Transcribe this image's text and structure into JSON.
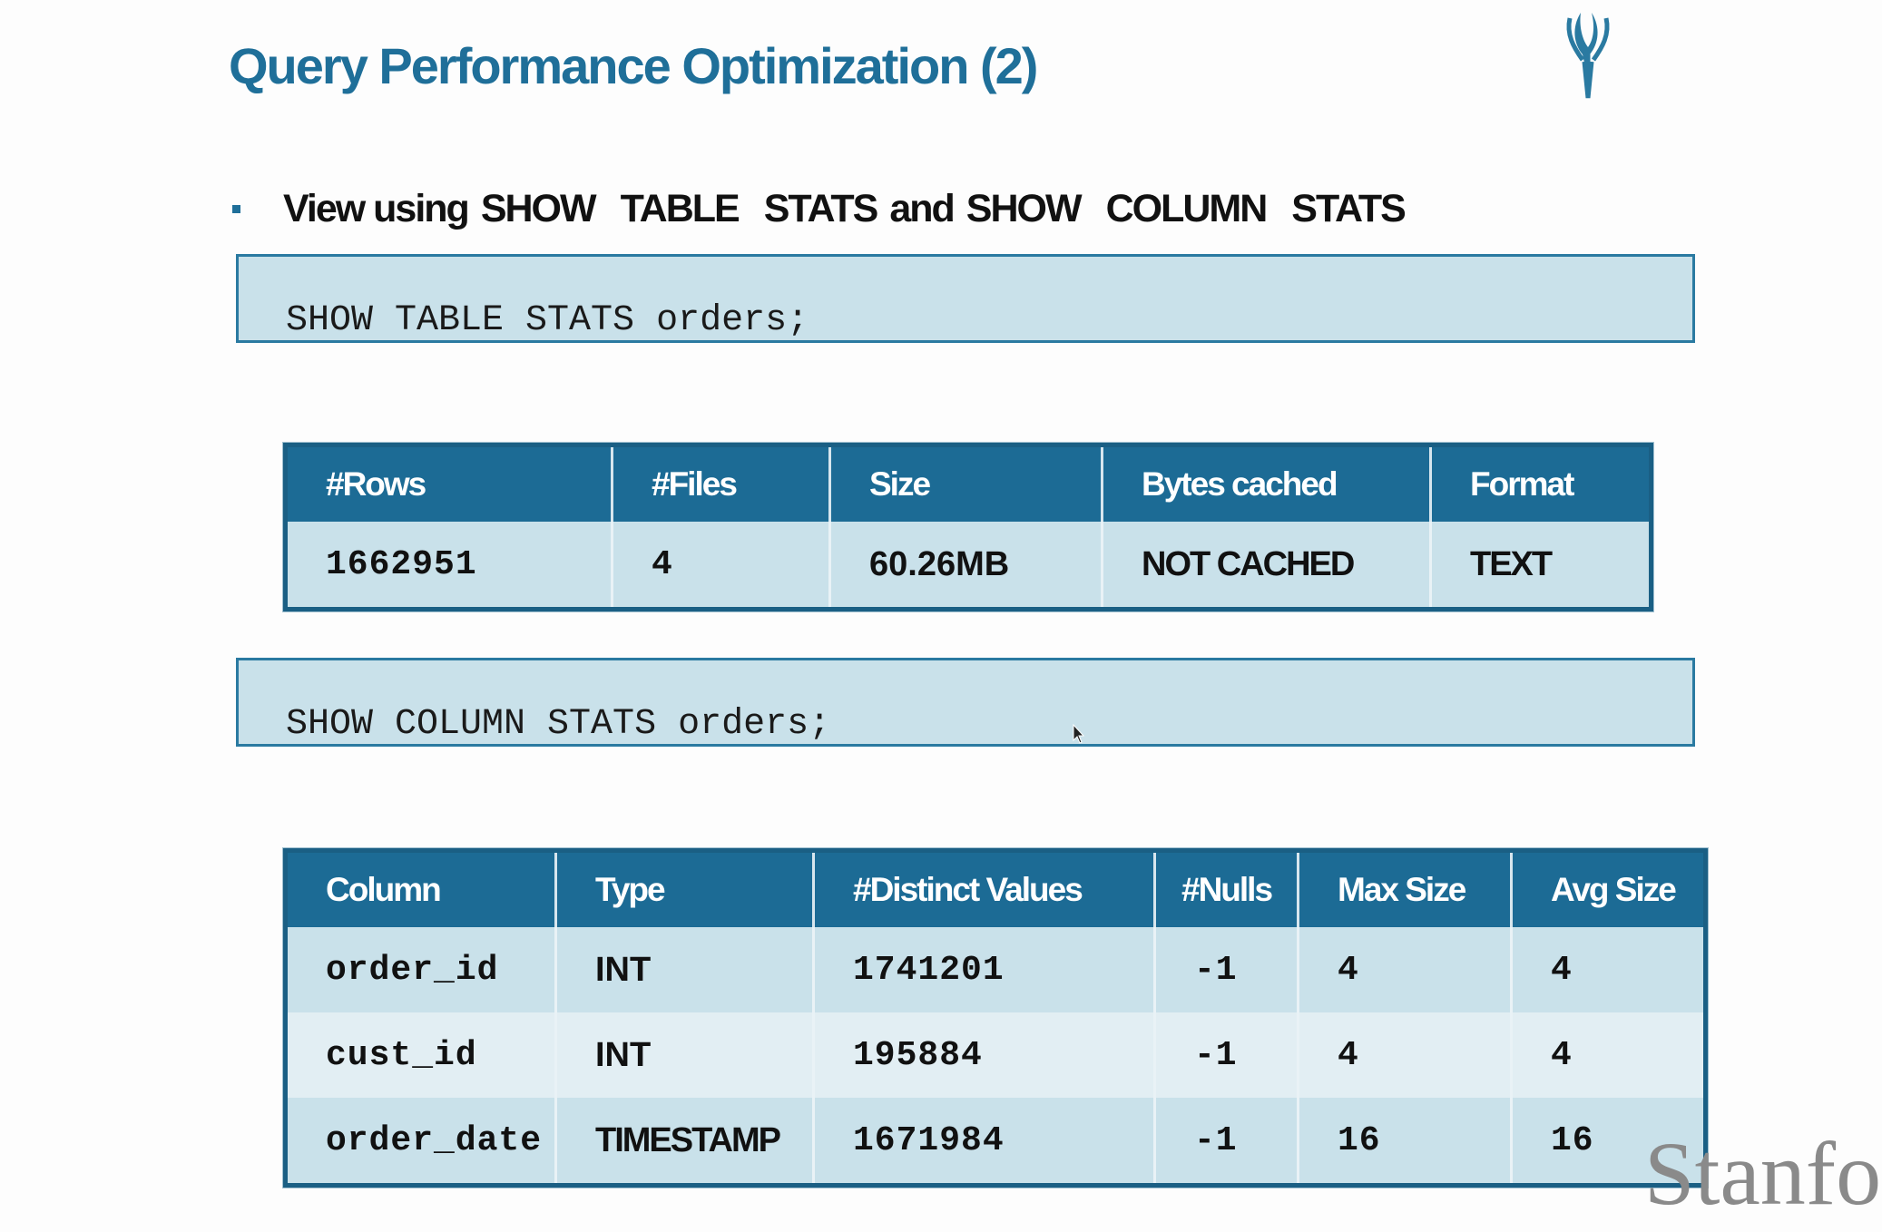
{
  "title": "Query Performance Optimization (2)",
  "bullet": {
    "prefix": "View using",
    "keyword_1a": "SHOW",
    "keyword_1b": "TABLE",
    "keyword_1c": "STATS",
    "joiner": "and",
    "keyword_2a": "SHOW",
    "keyword_2b": "COLUMN",
    "keyword_2c": "STATS"
  },
  "code_1": "SHOW TABLE STATS orders;",
  "code_2": "SHOW COLUMN STATS orders;",
  "table_stats": {
    "headers": [
      "#Rows",
      "#Files",
      "Size",
      "Bytes cached",
      "Format"
    ],
    "rows": [
      [
        "1662951",
        "4",
        "60.26MB",
        "NOT CACHED",
        "TEXT"
      ]
    ]
  },
  "column_stats": {
    "headers": [
      "Column",
      "Type",
      "#Distinct Values",
      "#Nulls",
      "Max Size",
      "Avg Size"
    ],
    "rows": [
      [
        "order_id",
        "INT",
        "1741201",
        "-1",
        "4",
        "4"
      ],
      [
        "cust_id",
        "INT",
        "195884",
        "-1",
        "4",
        "4"
      ],
      [
        "order_date",
        "TIMESTAMP",
        "1671984",
        "-1",
        "16",
        "16"
      ]
    ]
  },
  "watermark": "Stanfo",
  "colors": {
    "title": "#1f6f99",
    "header_bg": "#1c6b95",
    "code_bg": "#c9e1ea",
    "row_odd": "#c9e1ea",
    "row_even": "#e2eef3"
  },
  "icons": [
    "impala-logo-icon",
    "mouse-cursor-icon"
  ]
}
